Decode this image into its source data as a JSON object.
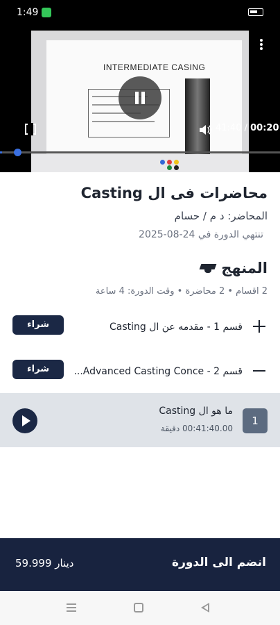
{
  "status_bar": {
    "time": "1:49"
  },
  "video": {
    "slide_title": "INTERMEDIATE CASING",
    "elapsed": "00:20",
    "duration": "41:40",
    "separator": " / ",
    "progress_fraction": 0.008
  },
  "course": {
    "title": "محاضرات فى ال Casting",
    "instructor": "المحاضر: د م / حسام",
    "ends": "تنتهي الدورة في 24-08-2025"
  },
  "curriculum": {
    "heading": "المنهج",
    "meta": "2 اقسام  •  2 محاضرة  •  وقت الدورة: 4 ساعة",
    "sections": [
      {
        "name": "قسم 1 - مقدمه عن ال Casting",
        "buy_label": "شراء",
        "expanded": false
      },
      {
        "name": "قسم 2 - Advanced Casting Conce...",
        "buy_label": "شراء",
        "expanded": true
      }
    ],
    "lessons": [
      {
        "number": "1",
        "title": "ما هو ال Casting",
        "duration": "00:41:40.00 دقيقة"
      }
    ]
  },
  "footer": {
    "join_label": "انضم الى الدورة",
    "price": "59.999 دينار"
  },
  "icons": [
    "pause-icon",
    "fullscreen-icon",
    "kebab-menu-icon",
    "volume-icon",
    "graduation-cap-icon",
    "plus-icon",
    "minus-icon",
    "play-icon",
    "nav-menu-icon",
    "nav-home-icon",
    "nav-back-icon"
  ],
  "colors": {
    "primary": "#1b2845",
    "lesson_bg": "#dfe3e8",
    "progress": "#3a6fe0"
  }
}
